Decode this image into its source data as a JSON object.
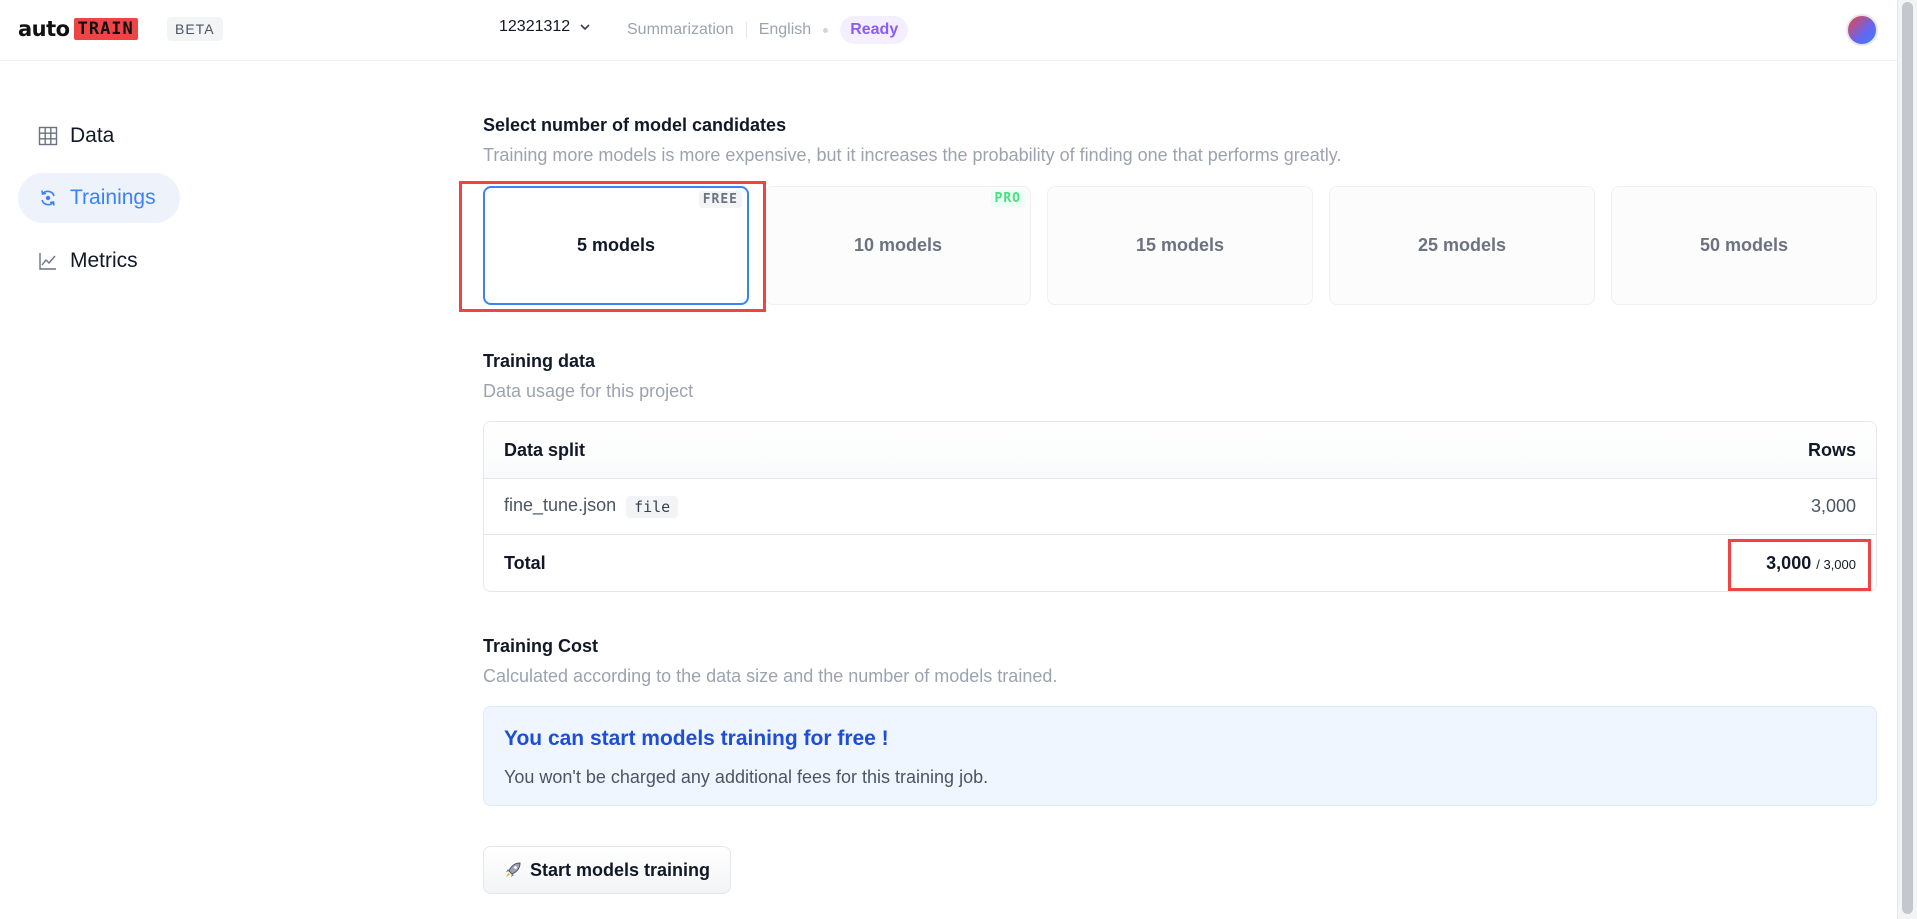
{
  "header": {
    "logo_auto": "auto",
    "logo_train": "TRAIN",
    "beta": "BETA",
    "project_name": "12321312",
    "task": "Summarization",
    "language": "English",
    "status": "Ready"
  },
  "sidebar": {
    "items": [
      {
        "label": "Data",
        "icon": "grid-icon",
        "active": false
      },
      {
        "label": "Trainings",
        "icon": "refresh-icon",
        "active": true
      },
      {
        "label": "Metrics",
        "icon": "chart-icon",
        "active": false
      }
    ]
  },
  "models": {
    "title": "Select number of model candidates",
    "subtitle": "Training more models is more expensive, but it increases the probability of finding one that performs greatly.",
    "options": [
      {
        "label": "5 models",
        "badge": "FREE",
        "selected": true
      },
      {
        "label": "10 models",
        "badge": "PRO",
        "selected": false
      },
      {
        "label": "15 models",
        "badge": "",
        "selected": false
      },
      {
        "label": "25 models",
        "badge": "",
        "selected": false
      },
      {
        "label": "50 models",
        "badge": "",
        "selected": false
      }
    ]
  },
  "training_data": {
    "title": "Training data",
    "subtitle": "Data usage for this project",
    "table": {
      "col_split": "Data split",
      "col_rows": "Rows",
      "rows": [
        {
          "name": "fine_tune.json",
          "tag": "file",
          "rows": "3,000"
        }
      ],
      "total_label": "Total",
      "total_value": "3,000",
      "total_max": "/ 3,000"
    }
  },
  "cost": {
    "title": "Training Cost",
    "subtitle": "Calculated according to the data size and the number of models trained.",
    "alert_title": "You can start models training for free !",
    "alert_text": "You won't be charged any additional fees for this training job."
  },
  "actions": {
    "start_label": "Start models training"
  },
  "colors": {
    "accent": "#3b82f6",
    "highlight": "#ef4444",
    "status": "#8b5cf6"
  }
}
